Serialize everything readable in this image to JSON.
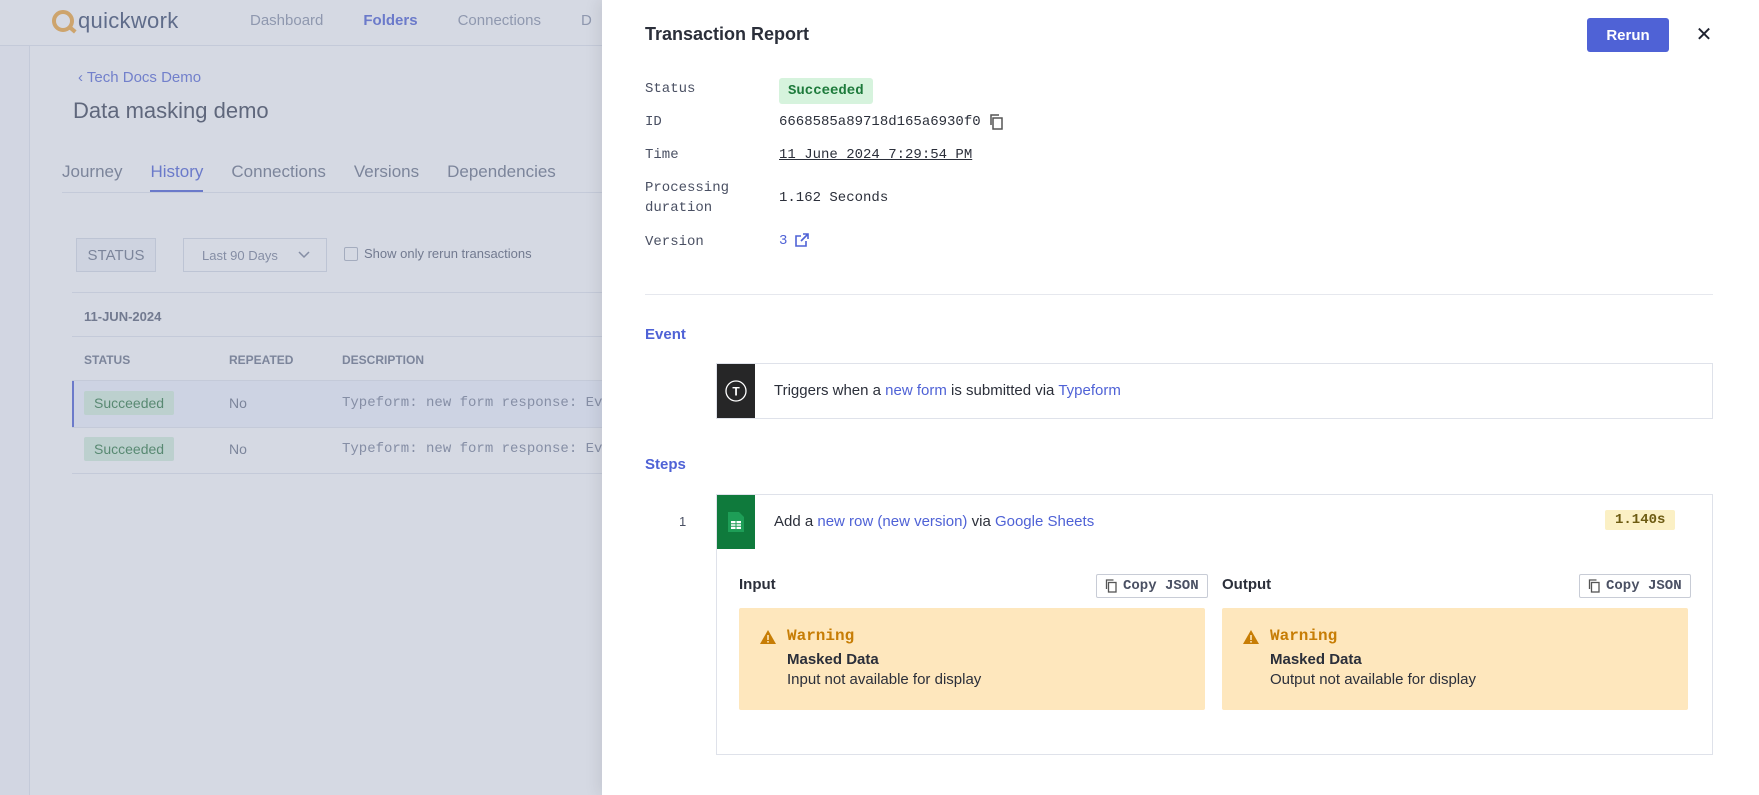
{
  "app": {
    "logo_text": "quickwork",
    "nav": [
      "Dashboard",
      "Folders",
      "Connections",
      "D"
    ],
    "breadcrumb": "‹ Tech Docs Demo",
    "page_title": "Data masking demo",
    "tabs": [
      "Journey",
      "History",
      "Connections",
      "Versions",
      "Dependencies"
    ],
    "filter_status": "STATUS",
    "filter_range": "Last 90 Days",
    "rerun_only_label": "Show only rerun transactions",
    "date_group": "11-JUN-2024",
    "columns": [
      "STATUS",
      "REPEATED",
      "DESCRIPTION"
    ],
    "rows": [
      {
        "status": "Succeeded",
        "repeated": "No",
        "description": "Typeform: new form response: Eve"
      },
      {
        "status": "Succeeded",
        "repeated": "No",
        "description": "Typeform: new form response: Eve"
      }
    ]
  },
  "panel": {
    "title": "Transaction Report",
    "rerun_label": "Rerun",
    "close_symbol": "✕",
    "meta": {
      "status_label": "Status",
      "status_value": "Succeeded",
      "id_label": "ID",
      "id_value": "6668585a89718d165a6930f0",
      "time_label": "Time",
      "time_value": "11 June 2024 7:29:54 PM",
      "duration_label_1": "Processing",
      "duration_label_2": "duration",
      "duration_value": "1.162 Seconds",
      "version_label": "Version",
      "version_value": "3"
    },
    "event": {
      "section_title": "Event",
      "icon": "typeform-icon",
      "icon_letter": "T",
      "text_1": "Triggers when a ",
      "link_1": "new form",
      "text_2": " is submitted via ",
      "link_2": "Typeform"
    },
    "steps": {
      "section_title": "Steps",
      "items": [
        {
          "number": "1",
          "icon": "google-sheets-icon",
          "text_1": "Add a ",
          "link_1": "new row (new version)",
          "text_2": " via ",
          "link_2": "Google Sheets",
          "duration": "1.140s",
          "input": {
            "title": "Input",
            "copy_label": "Copy JSON",
            "warning_head": "Warning",
            "warning_title": "Masked Data",
            "warning_msg": "Input not available for display"
          },
          "output": {
            "title": "Output",
            "copy_label": "Copy JSON",
            "warning_head": "Warning",
            "warning_title": "Masked Data",
            "warning_msg": "Output not available for display"
          }
        }
      ]
    }
  },
  "colors": {
    "accent": "#4f62d6",
    "success_bg": "#d6f3dd",
    "warning_bg": "#fee7bd",
    "warning_text": "#c77d05",
    "sheets_green": "#0f7a3c",
    "typeform_dark": "#262627"
  }
}
